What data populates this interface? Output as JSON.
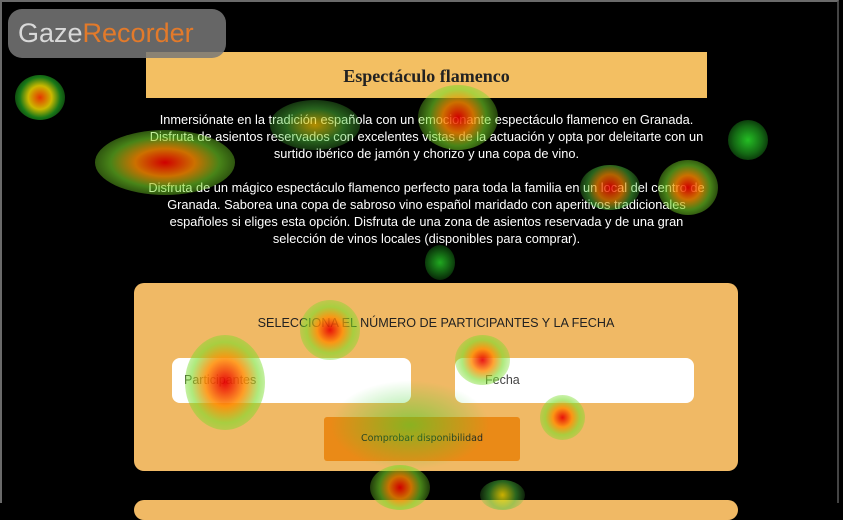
{
  "overlay": {
    "brand_part1": "Gaze",
    "brand_part2": "Recorder"
  },
  "page": {
    "title": "Espectáculo flamenco",
    "paragraph1": "Inmersiónate en la tradición española con un emocionante espectáculo flamenco en Granada. Disfruta de asientos reservados con excelentes vistas de la actuación y opta por deleitarte con un surtido ibérico de jamón y chorizo y una copa de vino.",
    "paragraph2": "Disfruta de un mágico espectáculo flamenco perfecto para toda la familia en un local del centro de Granada. Saborea una copa de sabroso vino español maridado con aperitivos tradicionales españoles si eliges esta opción. Disfruta de una zona de asientos reservada y de una gran selección de vinos locales (disponibles para comprar)."
  },
  "booking": {
    "heading": "SELECCIONA EL NÚMERO DE PARTICIPANTES Y LA FECHA",
    "participants_placeholder": "Participantes",
    "date_placeholder": "Fecha",
    "check_button": "Comprobar disponibilidad"
  },
  "colors": {
    "accent": "#f3bf62",
    "card": "#f0b965",
    "button": "#ea8a17",
    "brand_orange": "#e37a2a"
  }
}
